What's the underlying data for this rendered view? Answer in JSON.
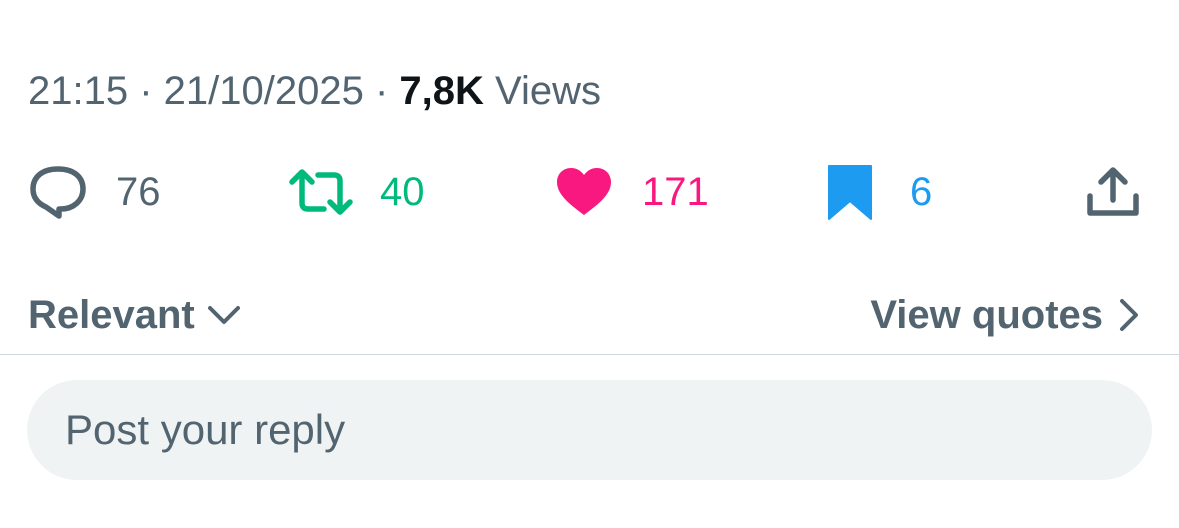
{
  "tweet_meta": {
    "time": "21:15",
    "separator_1": " · ",
    "date": "21/10/2025",
    "separator_2": " · ",
    "views_count": "7,8K",
    "views_label": " Views"
  },
  "actions": {
    "replies": {
      "icon": "reply-icon",
      "count": "76",
      "color": "#536471"
    },
    "reposts": {
      "icon": "repost-icon",
      "count": "40",
      "color": "#00ba7c"
    },
    "likes": {
      "icon": "heart-icon",
      "count": "171",
      "color": "#f91880"
    },
    "bookmarks": {
      "icon": "bookmark-icon",
      "count": "6",
      "color": "#1d9bf0"
    },
    "share": {
      "icon": "share-icon"
    }
  },
  "replies_section": {
    "sort_label": "Relevant",
    "sort_icon": "chevron-down-icon",
    "quotes_label": "View quotes",
    "quotes_icon": "chevron-right-icon"
  },
  "reply_composer": {
    "placeholder": "Post your reply",
    "value": ""
  }
}
